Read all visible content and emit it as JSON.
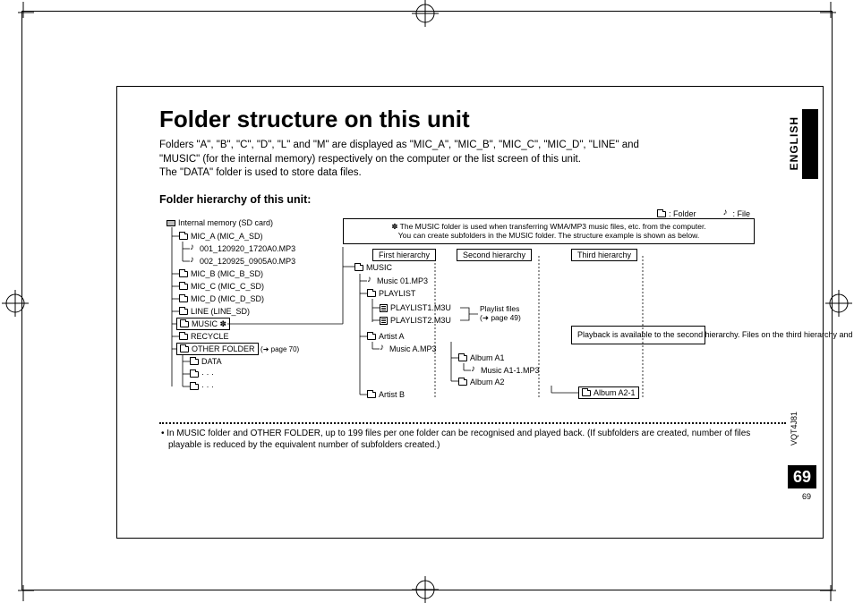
{
  "title": "Folder structure on this unit",
  "intro_l1": "Folders \"A\", \"B\", \"C\", \"D\", \"L\" and \"M\" are displayed as \"MIC_A\", \"MIC_B\", \"MIC_C\", \"MIC_D\", \"LINE\" and",
  "intro_l2": "\"MUSIC\" (for the internal memory) respectively on the computer or the list screen of this unit.",
  "intro_l3": "The \"DATA\" folder is used to store data files.",
  "subhead": "Folder hierarchy of this unit:",
  "language": "ENGLISH",
  "doc_code": "VQT4J81",
  "page_number": "69",
  "page_small": "69",
  "legend": {
    "folder": ": Folder",
    "file": ": File"
  },
  "left_tree": {
    "root": "Internal memory (SD card)",
    "mic_a": "MIC_A (MIC_A_SD)",
    "f1": "001_120920_1720A0.MP3",
    "f2": "002_120925_0905A0.MP3",
    "mic_b": "MIC_B (MIC_B_SD)",
    "mic_c": "MIC_C (MIC_C_SD)",
    "mic_d": "MIC_D (MIC_D_SD)",
    "line": "LINE (LINE_SD)",
    "music": "MUSIC ✽",
    "recycle": "RECYCLE",
    "other": "OTHER FOLDER",
    "other_ref": "(➜ page 70)",
    "data": "DATA",
    "dots": "· · ·"
  },
  "music_note_l1": "✽ The MUSIC folder is used when transferring WMA/MP3 music files, etc. from the computer.",
  "music_note_l2": "You can create subfolders in the MUSIC folder. The structure example is shown as below.",
  "hier": {
    "h1": "First hierarchy",
    "h2": "Second hierarchy",
    "h3": "Third hierarchy"
  },
  "right_tree": {
    "music": "MUSIC",
    "music01": "Music 01.MP3",
    "playlist": "PLAYLIST",
    "pl1": "PLAYLIST1.M3U",
    "pl2": "PLAYLIST2.M3U",
    "pl_note_l1": "Playlist files",
    "pl_note_l2": "(➜ page 49)",
    "artist_a": "Artist A",
    "music_a": "Music A.MP3",
    "album_a1": "Album A1",
    "music_a1": "Music A1-1.MP3",
    "album_a2": "Album A2",
    "album_a21": "Album A2-1",
    "artist_b": "Artist B"
  },
  "playback_note": "Playback is available to the second hierarchy. Files on the third hierarchy and after cannot be played.",
  "footnote": "• In MUSIC folder and OTHER FOLDER, up to 199 files per one folder can be recognised and played back. (If subfolders are created, number of files playable is reduced by the equivalent number of subfolders created.)"
}
